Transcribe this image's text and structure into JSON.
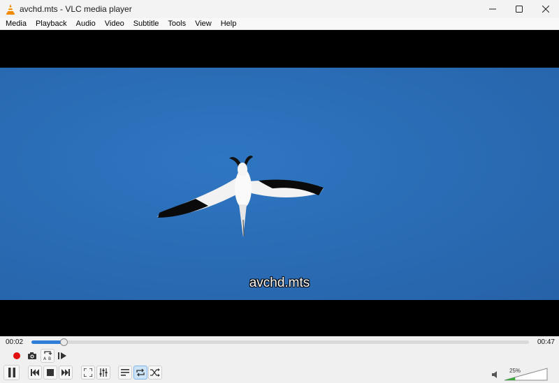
{
  "window": {
    "title": "avchd.mts - VLC media player",
    "icon": "vlc-cone-icon"
  },
  "menu": {
    "items": [
      "Media",
      "Playback",
      "Audio",
      "Video",
      "Subtitle",
      "Tools",
      "View",
      "Help"
    ]
  },
  "video": {
    "subtitle_text": "avchd.mts"
  },
  "seek": {
    "elapsed": "00:02",
    "total": "00:47",
    "progress_fraction": 0.064
  },
  "controls": {
    "row1": [
      "record-icon",
      "snapshot-icon",
      "ab-loop-icon",
      "frame-by-frame-icon"
    ],
    "row2": [
      "pause-icon",
      "previous-icon",
      "stop-icon",
      "next-icon",
      "fullscreen-icon",
      "extended-settings-icon",
      "playlist-icon",
      "loop-icon",
      "random-icon"
    ],
    "loop_active": true
  },
  "volume": {
    "label": "25%",
    "level_fraction": 0.25
  },
  "colors": {
    "accent": "#2f7ed8",
    "record": "#e01010",
    "vlc_orange": "#f08a00",
    "sky": "#2a6db6"
  }
}
